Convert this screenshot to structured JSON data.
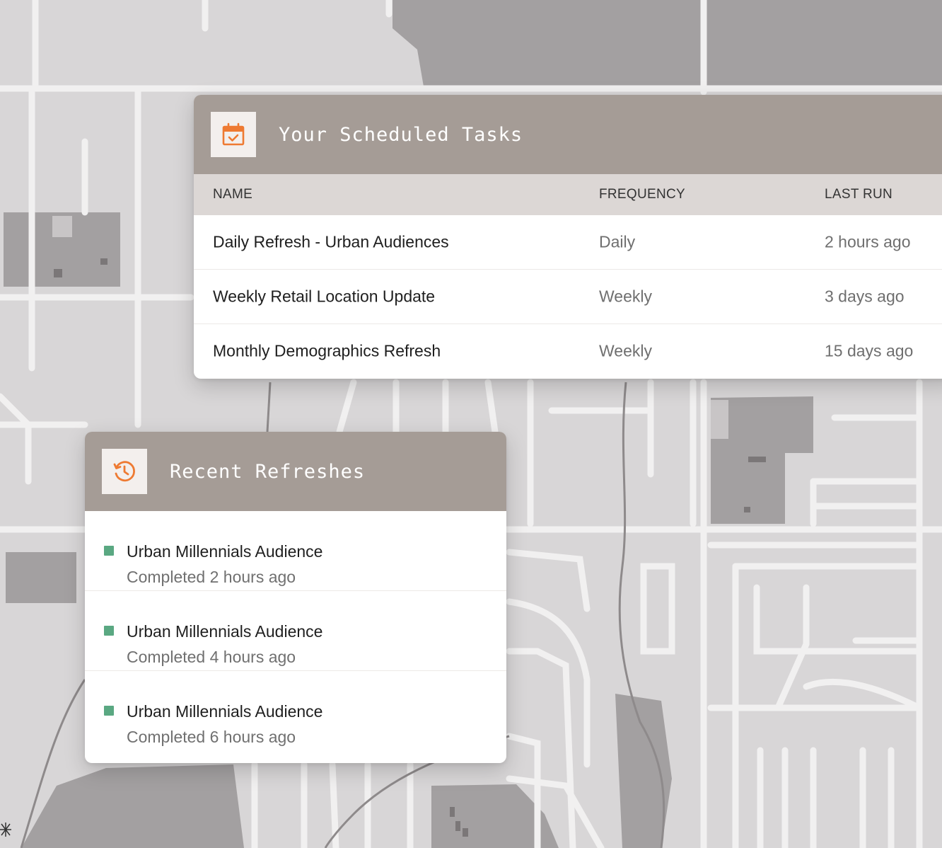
{
  "colors": {
    "header_bg": "#a59c96",
    "table_header_bg": "#dcd7d5",
    "icon_accent": "#ee7a32",
    "status_green": "#5aa882",
    "map_road": "#f1f0f0",
    "map_block": "#d8d6d7",
    "map_dark": "#a29e9f"
  },
  "scheduled": {
    "icon": "calendar-check-icon",
    "title": "Your Scheduled Tasks",
    "columns": {
      "name": "NAME",
      "frequency": "FREQUENCY",
      "last_run": "LAST RUN"
    },
    "rows": [
      {
        "name": "Daily Refresh - Urban Audiences",
        "frequency": "Daily",
        "last_run": "2 hours ago"
      },
      {
        "name": "Weekly Retail Location Update",
        "frequency": "Weekly",
        "last_run": "3 days ago"
      },
      {
        "name": "Monthly Demographics Refresh",
        "frequency": "Weekly",
        "last_run": "15 days ago"
      }
    ]
  },
  "recent": {
    "icon": "history-icon",
    "title": "Recent Refreshes",
    "items": [
      {
        "title": "Urban Millennials Audience",
        "status": "Completed 2 hours ago"
      },
      {
        "title": "Urban Millennials Audience",
        "status": "Completed 4 hours ago"
      },
      {
        "title": "Urban Millennials Audience",
        "status": "Completed 6 hours ago"
      }
    ]
  }
}
